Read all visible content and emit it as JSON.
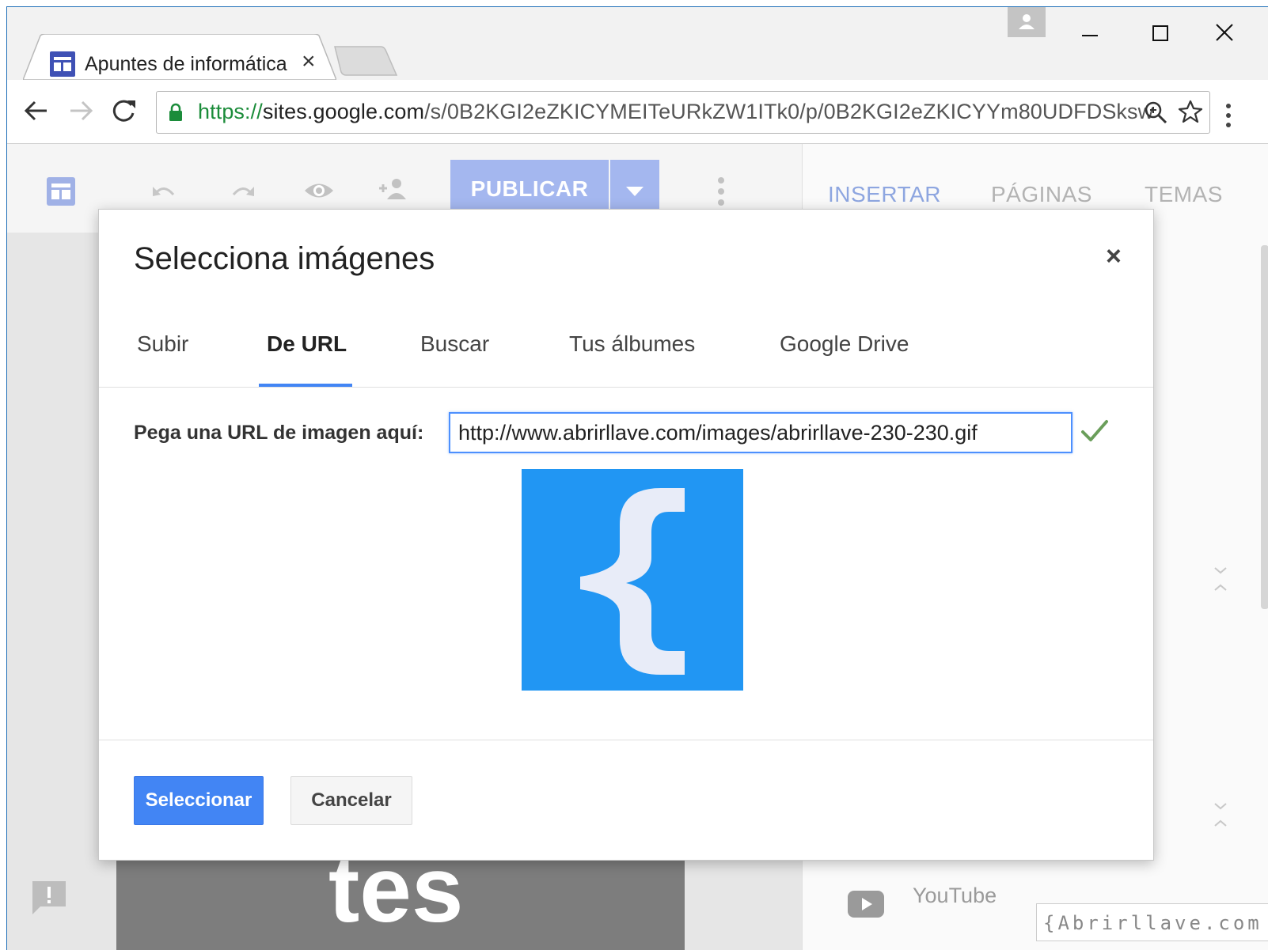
{
  "browser": {
    "tab_title": "Apuntes de informática",
    "tab_close": "×",
    "url_scheme": "https://",
    "url_host": "sites.google.com",
    "url_path": "/s/0B2KGI2eZKICYMEITeURkZW1ITk0/p/0B2KGI2eZKICYYm80UDFDSksw"
  },
  "editor": {
    "publish_label": "PUBLICAR",
    "side_tabs": [
      "INSERTAR",
      "PÁGINAS",
      "TEMAS"
    ],
    "hero_text": "tes",
    "youtube_label": "YouTube",
    "watermark": "{Abrirllave.com"
  },
  "dialog": {
    "title": "Selecciona imágenes",
    "close": "×",
    "tabs": [
      "Subir",
      "De URL",
      "Buscar",
      "Tus álbumes",
      "Google Drive"
    ],
    "active_tab": "De URL",
    "url_label": "Pega una URL de imagen aquí:",
    "url_value": "http://www.abrirllave.com/images/abrirllave-230-230.gif",
    "select_button": "Seleccionar",
    "cancel_button": "Cancelar"
  },
  "colors": {
    "accent": "#4285f4",
    "publish": "#a4b7ef",
    "preview_bg": "#2196f3",
    "preview_brace": "#e8ecf8"
  }
}
